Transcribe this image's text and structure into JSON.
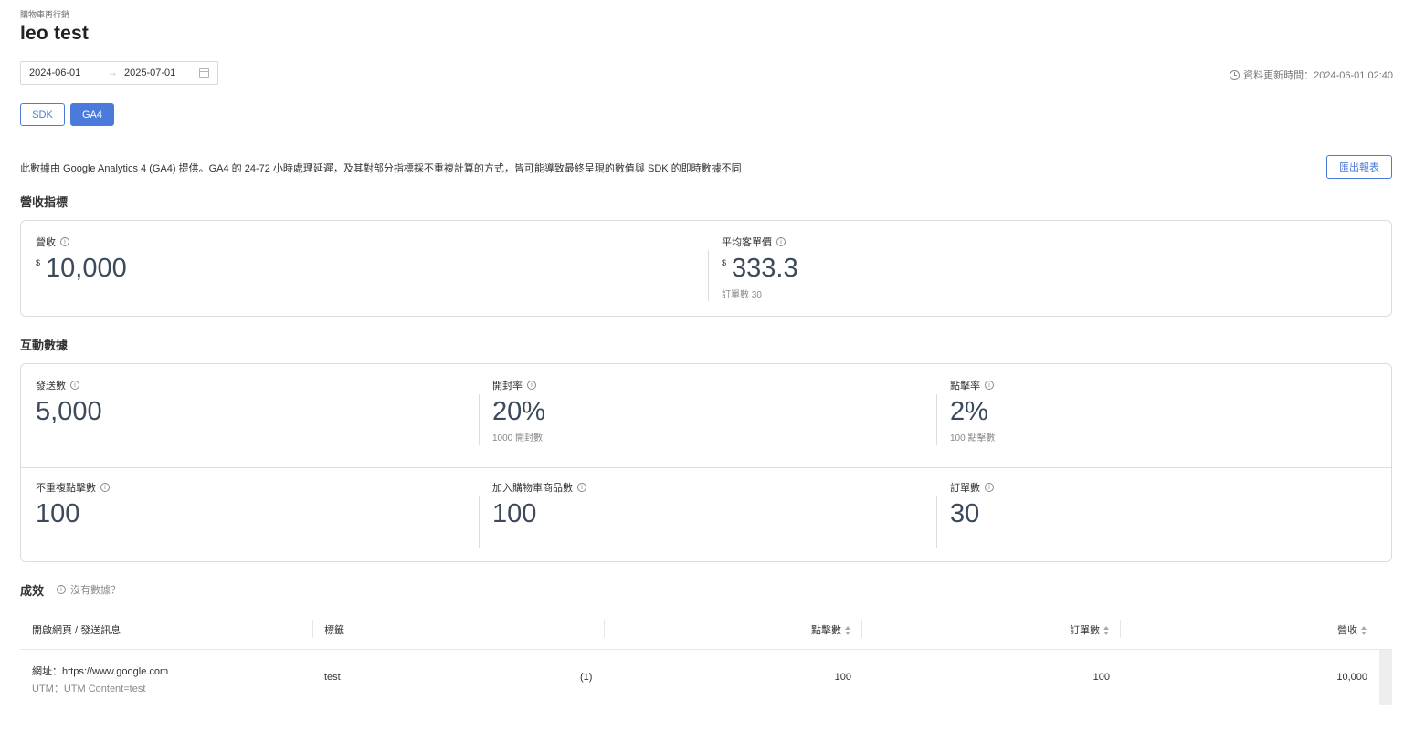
{
  "header": {
    "breadcrumb": "購物車再行銷",
    "title": "leo test"
  },
  "filters": {
    "start_date": "2024-06-01",
    "end_date": "2025-07-01",
    "arrow": "→",
    "update_time": "資料更新時間：2024-06-01 02:40"
  },
  "source_tabs": {
    "sdk_label": "SDK",
    "ga4_label": "GA4",
    "active": "GA4"
  },
  "notice": "此數據由 Google Analytics 4 (GA4) 提供。GA4 的 24-72 小時處理延遲，及其對部分指標採不重複計算的方式，皆可能導致最終呈現的數值與 SDK 的即時數據不同",
  "export_label": "匯出報表",
  "revenue_section": {
    "title": "營收指標",
    "revenue": {
      "label": "營收",
      "currency": "$",
      "value": "10,000"
    },
    "aov": {
      "label": "平均客單價",
      "currency": "$",
      "value": "333.3",
      "sub": "訂單數 30"
    }
  },
  "engagement_section": {
    "title": "互動數據",
    "sent": {
      "label": "發送數",
      "value": "5,000"
    },
    "open_rate": {
      "label": "開封率",
      "value": "20%",
      "sub": "1000 開封數"
    },
    "click_rate": {
      "label": "點擊率",
      "value": "2%",
      "sub": "100 點擊數"
    },
    "unique_clicks": {
      "label": "不重複點擊數",
      "value": "100"
    },
    "add_to_cart": {
      "label": "加入購物車商品數",
      "value": "100"
    },
    "orders": {
      "label": "訂單數",
      "value": "30"
    }
  },
  "performance": {
    "title": "成效",
    "no_data_label": "沒有數據？",
    "columns": [
      "開啟網頁 / 發送訊息",
      "標籤",
      "點擊數",
      "訂單數",
      "營收"
    ],
    "rows": [
      {
        "url": "網址：https://www.google.com",
        "utm": "UTM：UTM Content=test",
        "tag": "test",
        "tag_count": "(1)",
        "clicks": "100",
        "orders": "100",
        "revenue": "10,000"
      }
    ]
  },
  "colors": {
    "accent": "#4a7bdb",
    "value_text": "#3c4a5c",
    "border": "#dcdcdc"
  },
  "icons": [
    "clock-icon",
    "calendar-icon",
    "info-icon",
    "sort-icon"
  ]
}
